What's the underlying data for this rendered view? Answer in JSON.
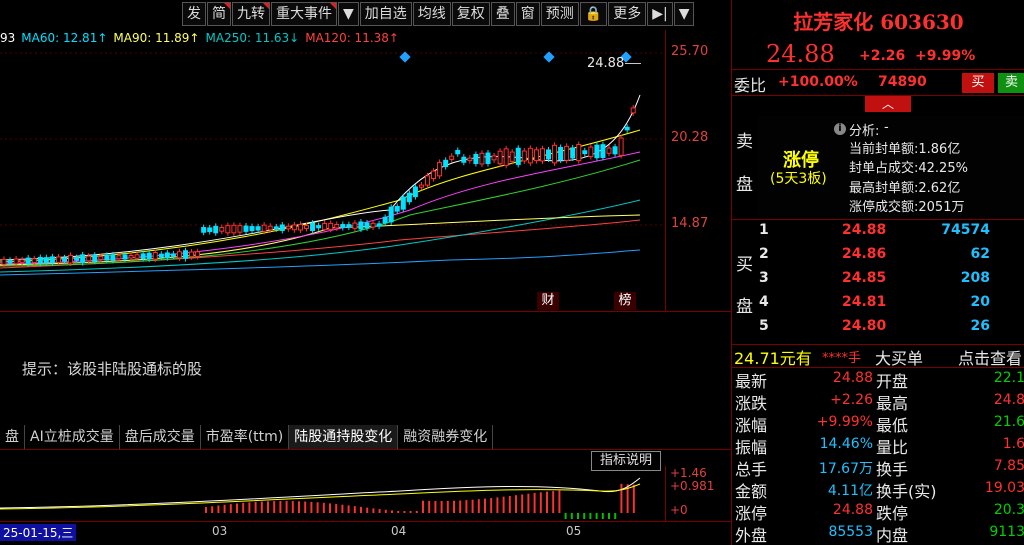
{
  "toolbar": {
    "buttons": [
      {
        "label": "发",
        "flag": false
      },
      {
        "label": "简",
        "flag": true
      },
      {
        "label": "九转",
        "flag": true
      },
      {
        "label": "重大事件",
        "flag": true
      },
      {
        "label": "▼",
        "flag": false
      },
      {
        "label": "加自选",
        "flag": false
      },
      {
        "label": "均线",
        "flag": false
      },
      {
        "label": "复权",
        "flag": false
      },
      {
        "label": "叠",
        "flag": false
      },
      {
        "label": "窗",
        "flag": false
      },
      {
        "label": "预测",
        "flag": false
      },
      {
        "label": "🔒",
        "flag": false
      },
      {
        "label": "更多",
        "flag": false
      },
      {
        "label": "▶|",
        "flag": false
      },
      {
        "label": "▼",
        "flag": false
      }
    ]
  },
  "ma_legend": [
    {
      "text": "93",
      "color": "#ffffff"
    },
    {
      "text": "MA60: 12.81↑",
      "color": "#00e0ff"
    },
    {
      "text": "MA90: 11.89↑",
      "color": "#ffff60"
    },
    {
      "text": "MA250: 11.63↓",
      "color": "#00c8c8"
    },
    {
      "text": "MA120: 11.38↑",
      "color": "#ff4040"
    }
  ],
  "chart": {
    "price_labels": [
      "25.70",
      "20.28",
      "14.87"
    ],
    "high_marker": "24.88",
    "event_marks": [
      "财",
      "榜"
    ],
    "hint": "提示：该股非陆股通标的股",
    "tabs": [
      {
        "label": "盘",
        "active": false
      },
      {
        "label": "AI立桩成交量",
        "active": false
      },
      {
        "label": "盘后成交量",
        "active": false
      },
      {
        "label": "市盈率(ttm)",
        "active": false
      },
      {
        "label": "陆股通持股变化",
        "active": true
      },
      {
        "label": "融资融券变化",
        "active": false
      }
    ],
    "indicator_button": "指标说明",
    "indicator_labels": [
      "+1.46",
      "+0.981",
      "+0"
    ],
    "date_labels": [
      "25-01-15,三",
      "03",
      "04",
      "05"
    ]
  },
  "stock": {
    "name_code": "拉芳家化 603630",
    "price": "24.88",
    "change": "+2.26",
    "change_pct": "+9.99%"
  },
  "order": {
    "label": "委比",
    "ratio": "+100.00%",
    "diff": "74890",
    "buy_button": "买",
    "sell_button": "卖"
  },
  "limit_info": {
    "sell_side_label": [
      "卖",
      "盘"
    ],
    "title": "涨停",
    "subtitle": "(5天3板)",
    "analysis_label": "分析:",
    "analysis_value": "-",
    "lines": [
      "当前封单额:1.86亿",
      "封单占成交:42.25%",
      "最高封单额:2.62亿",
      "涨停成交额:2051万"
    ]
  },
  "buy_book": {
    "side_label": [
      "买",
      "盘"
    ],
    "rows": [
      {
        "level": "1",
        "price": "24.88",
        "volume": "74574"
      },
      {
        "level": "2",
        "price": "24.86",
        "volume": "62"
      },
      {
        "level": "3",
        "price": "24.85",
        "volume": "208"
      },
      {
        "level": "4",
        "price": "24.81",
        "volume": "20"
      },
      {
        "level": "5",
        "price": "24.80",
        "volume": "26"
      }
    ]
  },
  "big_order": {
    "price": "24.71元有",
    "qty": "****手",
    "label": "大买单",
    "action": "点击查看"
  },
  "quotes": [
    {
      "l1": "最新",
      "v1": "24.88",
      "l2": "开盘",
      "v2": "22.1"
    },
    {
      "l1": "涨跌",
      "v1": "+2.26",
      "l2": "最高",
      "v2": "24.8"
    },
    {
      "l1": "涨幅",
      "v1": "+9.99%",
      "l2": "最低",
      "v2": "21.6"
    },
    {
      "l1": "振幅",
      "v1": "14.46%",
      "l2": "量比",
      "v2": "1.6"
    },
    {
      "l1": "总手",
      "v1": "17.67万",
      "l2": "换手",
      "v2": "7.85"
    },
    {
      "l1": "金额",
      "v1": "4.11亿",
      "l2": "换手(实)",
      "v2": "19.03"
    },
    {
      "l1": "涨停",
      "v1": "24.88",
      "l2": "跌停",
      "v2": "20.3"
    },
    {
      "l1": "外盘",
      "v1": "85553",
      "l2": "内盘",
      "v2": "9113"
    }
  ]
}
